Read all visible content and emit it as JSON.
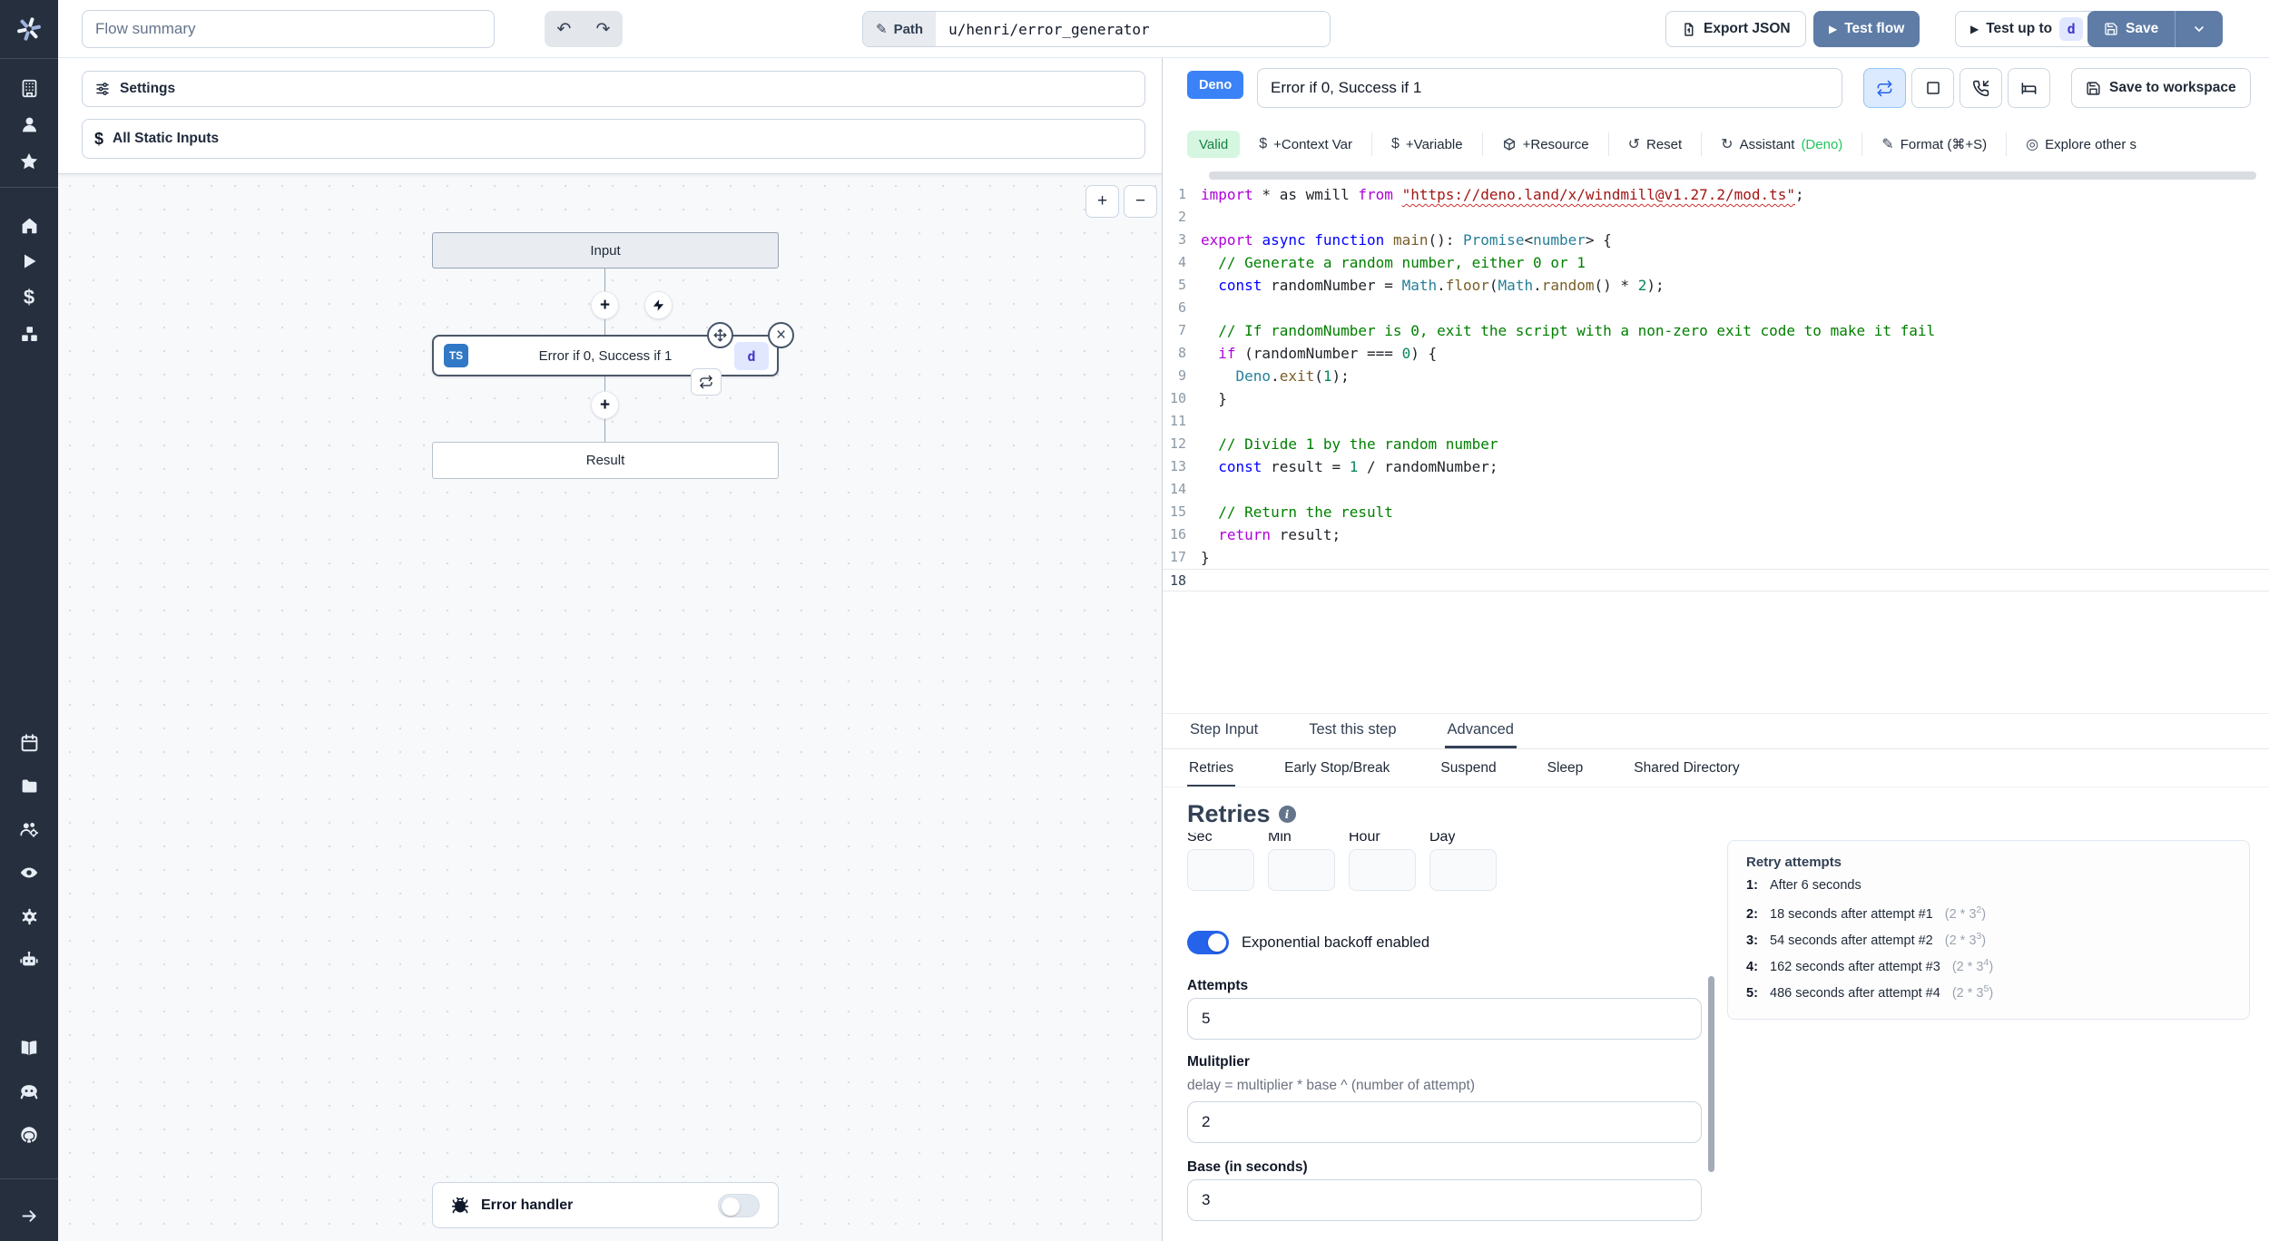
{
  "colors": {
    "sidebar_bg": "#262f3e",
    "primary_button_blue": "#5e7ca6",
    "deno_badge_blue": "#3b82f6",
    "ts_badge_blue": "#3178c6",
    "kbd_badge_bg": "#e0e7ff",
    "kbd_badge_text": "#4338ca",
    "valid_badge_bg": "#d5f6e0",
    "valid_badge_text": "#178043",
    "deno_green": "#22c55e",
    "toggle_on_blue": "#2563eb"
  },
  "icons": {
    "undo": "↶",
    "redo": "↷",
    "pencil": "✎",
    "play": "▶",
    "reset": "↺",
    "assistant": "↻",
    "explore": "◎",
    "dollar": "$",
    "plus": "+",
    "minus": "−",
    "close": "×"
  },
  "topbar": {
    "flow_summary_placeholder": "Flow summary",
    "path_label": "Path",
    "path_value": "u/henri/error_generator",
    "export_json": "Export JSON",
    "test_flow": "Test flow",
    "test_up_to": "Test up to",
    "test_up_to_badge": "d",
    "save": "Save"
  },
  "canvas": {
    "settings": "Settings",
    "all_static_inputs": "All Static Inputs",
    "input_node": "Input",
    "step_node_label": "Error if 0, Success if 1",
    "step_lang_badge": "TS",
    "step_id_badge": "d",
    "result_node": "Result",
    "error_handler": "Error handler"
  },
  "editor_header": {
    "lang_badge": "Deno",
    "step_name": "Error if 0, Success if 1",
    "save_to_workspace": "Save to workspace"
  },
  "editor_toolbar": {
    "valid": "Valid",
    "context_var": "+Context Var",
    "variable": "+Variable",
    "resource": "+Resource",
    "reset": "Reset",
    "assistant": "Assistant",
    "assistant_lang": "(Deno)",
    "format": "Format (⌘+S)",
    "explore": "Explore other s"
  },
  "code": {
    "active_line": 18,
    "lines": [
      [
        [
          "k",
          "import"
        ],
        [
          "p",
          " * as wmill "
        ],
        [
          "k",
          "from"
        ],
        [
          "p",
          " "
        ],
        [
          "serr",
          "\"https://deno.land/x/windmill@v1.27.2/mod.ts\""
        ],
        [
          "p",
          ";"
        ]
      ],
      [],
      [
        [
          "k",
          "export"
        ],
        [
          "p",
          " "
        ],
        [
          "d",
          "async"
        ],
        [
          "p",
          " "
        ],
        [
          "d",
          "function"
        ],
        [
          "p",
          " "
        ],
        [
          "f",
          "main"
        ],
        [
          "p",
          "(): "
        ],
        [
          "t",
          "Promise"
        ],
        [
          "p",
          "<"
        ],
        [
          "t",
          "number"
        ],
        [
          "p",
          "> {"
        ]
      ],
      [
        [
          "c",
          "  // Generate a random number, either 0 or 1"
        ]
      ],
      [
        [
          "p",
          "  "
        ],
        [
          "d",
          "const"
        ],
        [
          "p",
          " randomNumber = "
        ],
        [
          "t",
          "Math"
        ],
        [
          "p",
          "."
        ],
        [
          "f",
          "floor"
        ],
        [
          "p",
          "("
        ],
        [
          "t",
          "Math"
        ],
        [
          "p",
          "."
        ],
        [
          "f",
          "random"
        ],
        [
          "p",
          "() * "
        ],
        [
          "n",
          "2"
        ],
        [
          "p",
          ");"
        ]
      ],
      [],
      [
        [
          "c",
          "  // If randomNumber is 0, exit the script with a non-zero exit code to make it fail"
        ]
      ],
      [
        [
          "p",
          "  "
        ],
        [
          "k",
          "if"
        ],
        [
          "p",
          " (randomNumber === "
        ],
        [
          "n",
          "0"
        ],
        [
          "p",
          ") {"
        ]
      ],
      [
        [
          "p",
          "    "
        ],
        [
          "t",
          "Deno"
        ],
        [
          "p",
          "."
        ],
        [
          "f",
          "exit"
        ],
        [
          "p",
          "("
        ],
        [
          "n",
          "1"
        ],
        [
          "p",
          ");"
        ]
      ],
      [
        [
          "p",
          "  }"
        ]
      ],
      [],
      [
        [
          "c",
          "  // Divide 1 by the random number"
        ]
      ],
      [
        [
          "p",
          "  "
        ],
        [
          "d",
          "const"
        ],
        [
          "p",
          " result = "
        ],
        [
          "n",
          "1"
        ],
        [
          "p",
          " / randomNumber;"
        ]
      ],
      [],
      [
        [
          "c",
          "  // Return the result"
        ]
      ],
      [
        [
          "p",
          "  "
        ],
        [
          "k",
          "return"
        ],
        [
          "p",
          " result;"
        ]
      ],
      [
        [
          "p",
          "}"
        ]
      ],
      []
    ]
  },
  "step_tabs": [
    {
      "label": "Step Input"
    },
    {
      "label": "Test this step"
    },
    {
      "label": "Advanced"
    }
  ],
  "advanced_tabs": [
    {
      "label": "Retries"
    },
    {
      "label": "Early Stop/Break"
    },
    {
      "label": "Suspend"
    },
    {
      "label": "Sleep"
    },
    {
      "label": "Shared Directory"
    }
  ],
  "retries": {
    "title": "Retries",
    "time_labels": [
      "Sec",
      "Min",
      "Hour",
      "Day"
    ],
    "backoff_label": "Exponential backoff enabled",
    "attempts_label": "Attempts",
    "attempts_value": "5",
    "multiplier_label": "Mulitplier",
    "multiplier_help": "delay = multiplier * base ^ (number of attempt)",
    "multiplier_value": "2",
    "base_label": "Base (in seconds)",
    "base_value": "3"
  },
  "retry_attempts": {
    "title": "Retry attempts",
    "items": [
      {
        "num": "1:",
        "text": "After 6 seconds",
        "fopen": "",
        "fexp": "",
        "fclose": ""
      },
      {
        "num": "2:",
        "text": "18 seconds after attempt #1",
        "fopen": "(2 * 3",
        "fexp": "2",
        "fclose": ")"
      },
      {
        "num": "3:",
        "text": "54 seconds after attempt #2",
        "fopen": "(2 * 3",
        "fexp": "3",
        "fclose": ")"
      },
      {
        "num": "4:",
        "text": "162 seconds after attempt #3",
        "fopen": "(2 * 3",
        "fexp": "4",
        "fclose": ")"
      },
      {
        "num": "5:",
        "text": "486 seconds after attempt #4",
        "fopen": "(2 * 3",
        "fexp": "5",
        "fclose": ")"
      }
    ]
  }
}
